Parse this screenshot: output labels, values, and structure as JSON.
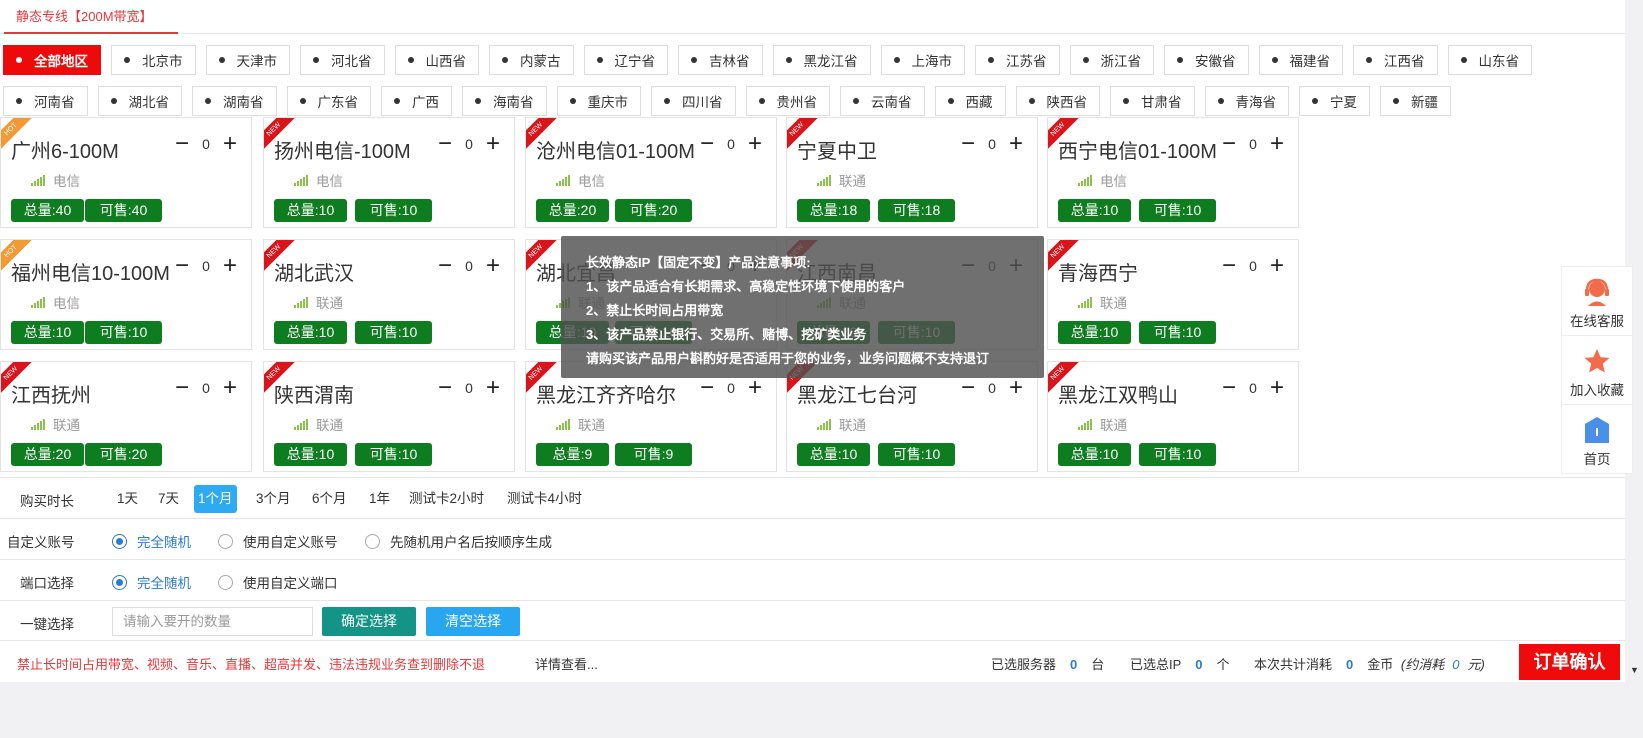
{
  "tab": {
    "label": "静态专线【200M带宽】"
  },
  "regions": [
    [
      "全部地区",
      "北京市",
      "天津市",
      "河北省",
      "山西省",
      "内蒙古",
      "辽宁省",
      "吉林省",
      "黑龙江省",
      "上海市",
      "江苏省",
      "浙江省",
      "安徽省",
      "福建省",
      "江西省",
      "山东省"
    ],
    [
      "河南省",
      "湖北省",
      "湖南省",
      "广东省",
      "广西",
      "海南省",
      "重庆市",
      "四川省",
      "贵州省",
      "云南省",
      "西藏",
      "陕西省",
      "甘肃省",
      "青海省",
      "宁夏",
      "新疆"
    ]
  ],
  "cards": [
    {
      "name": "广州6-100M",
      "tag": "HOT",
      "carrier": "电信",
      "qty": "0",
      "total": "总量:40",
      "avail": "可售:40"
    },
    {
      "name": "扬州电信-100M",
      "tag": "NEW",
      "carrier": "电信",
      "qty": "0",
      "total": "总量:10",
      "avail": "可售:10"
    },
    {
      "name": "沧州电信01-100M",
      "tag": "NEW",
      "carrier": "电信",
      "qty": "0",
      "total": "总量:20",
      "avail": "可售:20"
    },
    {
      "name": "宁夏中卫",
      "tag": "NEW",
      "carrier": "联通",
      "qty": "0",
      "total": "总量:18",
      "avail": "可售:18"
    },
    {
      "name": "西宁电信01-100M",
      "tag": "NEW",
      "carrier": "电信",
      "qty": "0",
      "total": "总量:10",
      "avail": "可售:10"
    },
    {
      "name": "福州电信10-100M",
      "tag": "HOT",
      "carrier": "电信",
      "qty": "0",
      "total": "总量:10",
      "avail": "可售:10"
    },
    {
      "name": "湖北武汉",
      "tag": "NEW",
      "carrier": "联通",
      "qty": "0",
      "total": "总量:10",
      "avail": "可售:10"
    },
    {
      "name": "湖北宜昌",
      "tag": "NEW",
      "carrier": "联通",
      "qty": "0",
      "total": "总量:10",
      "avail": "可售:10"
    },
    {
      "name": "江西南昌",
      "tag": "NEW",
      "carrier": "联通",
      "qty": "0",
      "total": "总量:10",
      "avail": "可售:10"
    },
    {
      "name": "青海西宁",
      "tag": "NEW",
      "carrier": "联通",
      "qty": "0",
      "total": "总量:10",
      "avail": "可售:10"
    },
    {
      "name": "江西抚州",
      "tag": "NEW",
      "carrier": "联通",
      "qty": "0",
      "total": "总量:20",
      "avail": "可售:20"
    },
    {
      "name": "陕西渭南",
      "tag": "NEW",
      "carrier": "联通",
      "qty": "0",
      "total": "总量:10",
      "avail": "可售:10"
    },
    {
      "name": "黑龙江齐齐哈尔",
      "tag": "NEW",
      "carrier": "联通",
      "qty": "0",
      "total": "总量:9",
      "avail": "可售:9"
    },
    {
      "name": "黑龙江七台河",
      "tag": "NEW",
      "carrier": "联通",
      "qty": "0",
      "total": "总量:10",
      "avail": "可售:10"
    },
    {
      "name": "黑龙江双鸭山",
      "tag": "NEW",
      "carrier": "联通",
      "qty": "0",
      "total": "总量:10",
      "avail": "可售:10"
    }
  ],
  "tooltip": {
    "lines": [
      "长效静态IP【固定不变】产品注意事项:",
      "1、该产品适合有长期需求、高稳定性环境下使用的客户",
      "2、禁止长时间占用带宽",
      "3、该产品禁止银行、交易所、赌博、挖矿类业务",
      "请购买该产品用户斟酌好是否适用于您的业务，业务问题概不支持退订"
    ]
  },
  "float_bar": {
    "service": "在线客服",
    "favorite": "加入收藏",
    "home": "首页"
  },
  "duration": {
    "label": "购买时长",
    "options": [
      "1天",
      "7天",
      "1个月",
      "3个月",
      "6个月",
      "1年",
      "测试卡2小时",
      "测试卡4小时"
    ],
    "selected": "1个月"
  },
  "account": {
    "label": "自定义账号",
    "options": [
      "完全随机",
      "使用自定义账号",
      "先随机用户名后按顺序生成"
    ],
    "selected": "完全随机"
  },
  "port": {
    "label": "端口选择",
    "options": [
      "完全随机",
      "使用自定义端口"
    ],
    "selected": "完全随机"
  },
  "quick": {
    "label": "一键选择",
    "placeholder": "请输入要开的数量",
    "confirm": "确定选择",
    "clear": "清空选择"
  },
  "footer": {
    "warning": "禁止长时间占用带宽、视频、音乐、直播、超高并发、违法违规业务查到删除不退",
    "detail": "详情查看...",
    "servers_label": "已选服务器",
    "servers": "0",
    "servers_unit": "台",
    "ips_label": "已选总IP",
    "ips": "0",
    "ips_unit": "个",
    "cost_label": "本次共计消耗",
    "cost": "0",
    "cost_unit": "金币",
    "approx_label": "(约消耗",
    "approx": "0",
    "approx_unit": "元)",
    "confirm": "订单确认"
  },
  "colors": {
    "accent_red": "#ee0a0a",
    "badge_green": "#0e7d1f",
    "active_blue": "#2eaaf3",
    "confirm_teal": "#139486",
    "clear_blue": "#29a6f0"
  }
}
